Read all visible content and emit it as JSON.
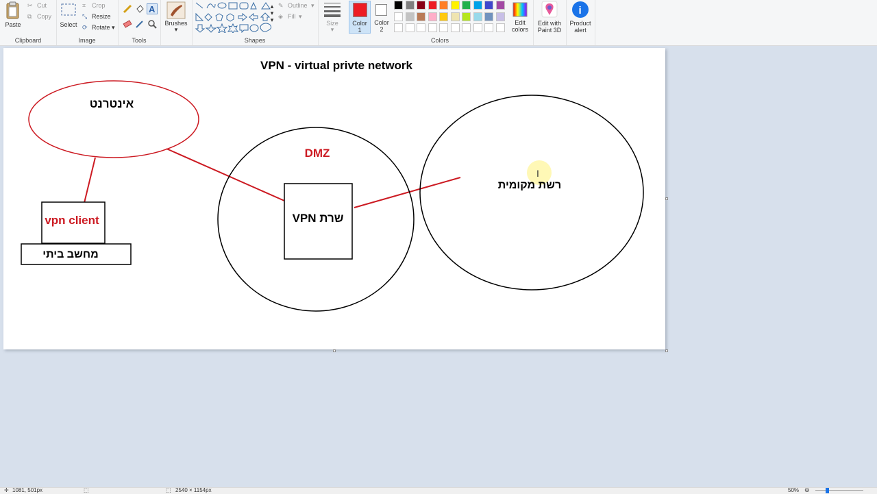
{
  "ribbon": {
    "clipboard": {
      "paste": "Paste",
      "cut": "Cut",
      "copy": "Copy",
      "label": "Clipboard"
    },
    "image": {
      "select": "Select",
      "crop": "Crop",
      "resize": "Resize",
      "rotate": "Rotate",
      "label": "Image"
    },
    "tools": {
      "label": "Tools"
    },
    "brushes": {
      "label": "Brushes"
    },
    "shapes": {
      "outline": "Outline",
      "fill": "Fill",
      "label": "Shapes"
    },
    "size": {
      "label": "Size"
    },
    "colors": {
      "color1": "Color 1",
      "color2": "Color 2",
      "edit": "Edit colors",
      "label": "Colors",
      "color1_value": "#ed1c24",
      "color2_value": "#ffffff",
      "palette_row1": [
        "#000000",
        "#7f7f7f",
        "#880015",
        "#ed1c24",
        "#ff7f27",
        "#fff200",
        "#22b14c",
        "#00a2e8",
        "#3f48cc",
        "#a349a4"
      ],
      "palette_row2": [
        "#ffffff",
        "#c3c3c3",
        "#b97a57",
        "#ffaec9",
        "#ffc90e",
        "#efe4b0",
        "#b5e61d",
        "#99d9ea",
        "#7092be",
        "#c8bfe7"
      ]
    },
    "paint3d": "Edit with Paint 3D",
    "product_alert": "Product alert"
  },
  "canvas": {
    "title": "VPN - virtual privte network",
    "internet": "אינטרנט",
    "dmz": "DMZ",
    "local_network": "רשת מקומית",
    "vpn_server": "שרת VPN",
    "vpn_client": "vpn client",
    "home_computer": "מחשב ביתי",
    "colors": {
      "red": "#cc1a22",
      "black": "#000000"
    }
  },
  "status": {
    "cursor_pos": "1081, 501px",
    "image_size": "2540 × 1154px",
    "zoom": "50%"
  }
}
